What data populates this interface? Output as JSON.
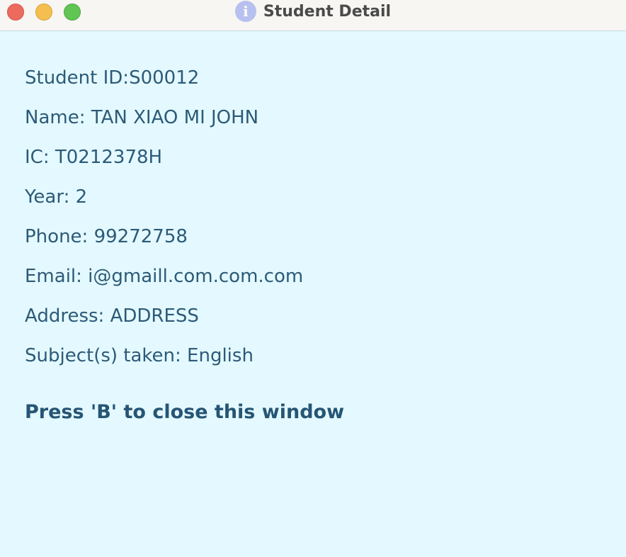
{
  "window": {
    "title": "Student Detail",
    "icon": "info-icon"
  },
  "student": {
    "id_line": "Student ID:S00012",
    "name_line": "Name: TAN XIAO MI JOHN",
    "ic_line": "IC: T0212378H",
    "year_line": "Year: 2",
    "phone_line": "Phone: 99272758",
    "email_line": "Email: i@gmaill.com.com.com",
    "address_line": "Address: ADDRESS",
    "subjects_line": "Subject(s) taken: English"
  },
  "instruction": "Press 'B' to close this window",
  "colors": {
    "background": "#e3f9ff",
    "text": "#2d5a78",
    "titlebar": "#f7f6f3"
  }
}
